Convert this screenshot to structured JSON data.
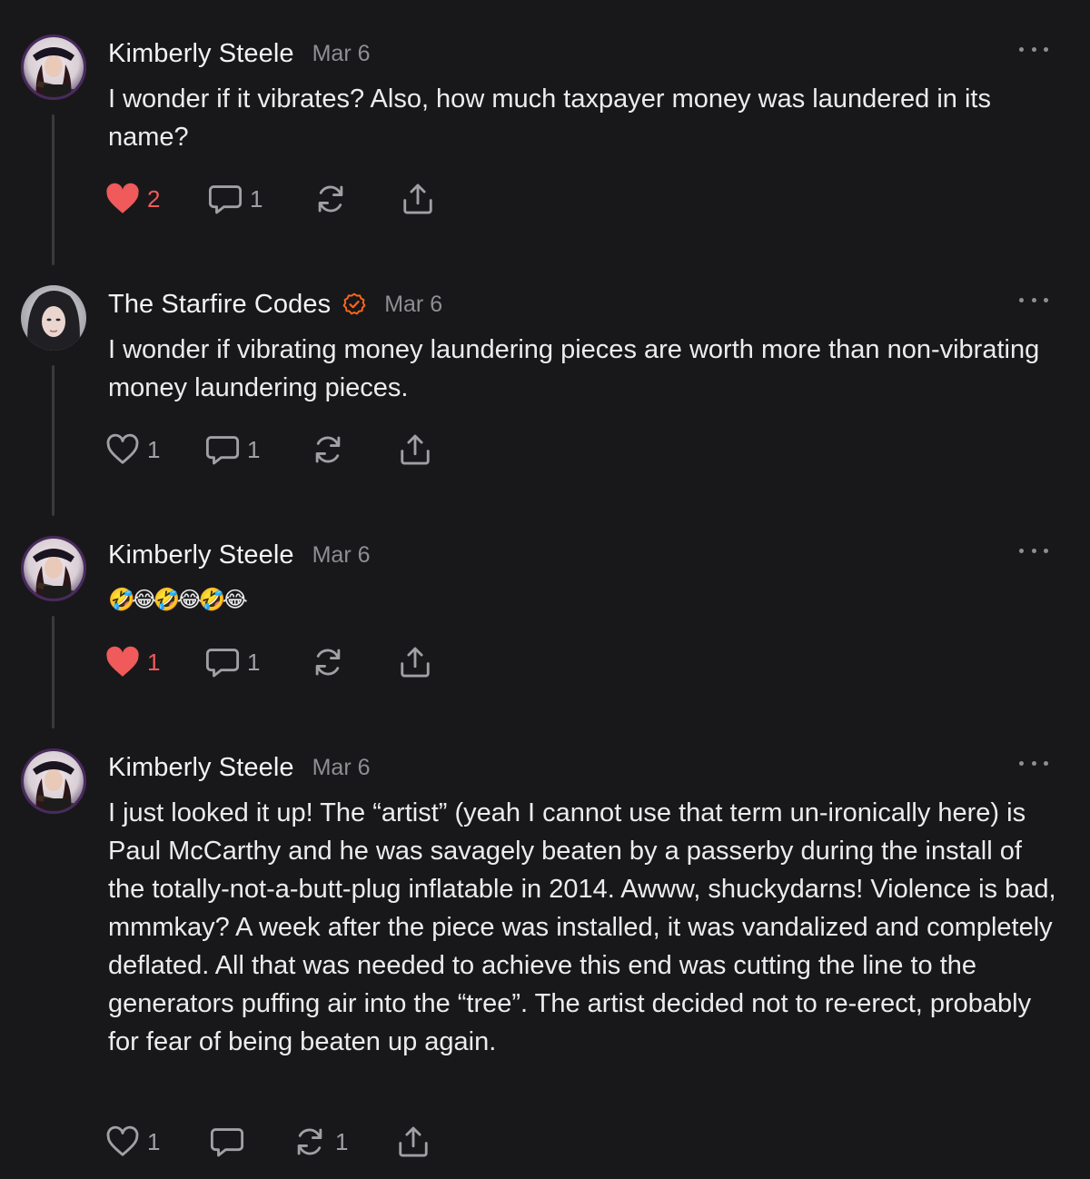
{
  "comments": [
    {
      "author": "Kimberly Steele",
      "date": "Mar 6",
      "body": "I wonder if it vibrates? Also, how much taxpayer money was laundered in its name?",
      "verified": false,
      "liked": true,
      "likes": "2",
      "replies": "1",
      "restacks": "",
      "icons": {
        "like": "heart-filled-icon",
        "reply": "comment-bubble-icon",
        "restack": "restack-icon",
        "share": "share-icon"
      }
    },
    {
      "author": "The Starfire Codes",
      "date": "Mar 6",
      "body": "I wonder if vibrating money laundering pieces are worth more than non-vibrating money laundering pieces.",
      "verified": true,
      "liked": false,
      "likes": "1",
      "replies": "1",
      "restacks": "",
      "icons": {
        "like": "heart-outline-icon",
        "reply": "comment-bubble-icon",
        "restack": "restack-icon",
        "share": "share-icon"
      }
    },
    {
      "author": "Kimberly Steele",
      "date": "Mar 6",
      "body": "🤣😂🤣😂🤣😂",
      "verified": false,
      "liked": true,
      "likes": "1",
      "replies": "1",
      "restacks": "",
      "icons": {
        "like": "heart-filled-icon",
        "reply": "comment-bubble-icon",
        "restack": "restack-icon",
        "share": "share-icon"
      }
    },
    {
      "author": "Kimberly Steele",
      "date": "Mar 6",
      "body": "I just looked it up! The “artist” (yeah I cannot use that term un-ironically here) is Paul McCarthy and he was savagely beaten by a passerby during the install of the totally-not-a-butt-plug inflatable in 2014. Awww, shuckydarns! Violence is bad, mmmkay? A week after the piece was installed, it was vandalized and completely deflated. All that was needed to achieve this end was cutting the line to the generators puffing air into the “tree”. The artist decided not to re-erect, probably for fear of being beaten up again.",
      "verified": false,
      "liked": false,
      "likes": "1",
      "replies": "",
      "restacks": "1",
      "icons": {
        "like": "heart-outline-icon",
        "reply": "comment-bubble-icon",
        "restack": "restack-icon",
        "share": "share-icon"
      }
    }
  ],
  "colors": {
    "background": "#18181a",
    "liked": "#f05a5a",
    "verified": "#ff6719",
    "muted": "#8e8e93"
  }
}
